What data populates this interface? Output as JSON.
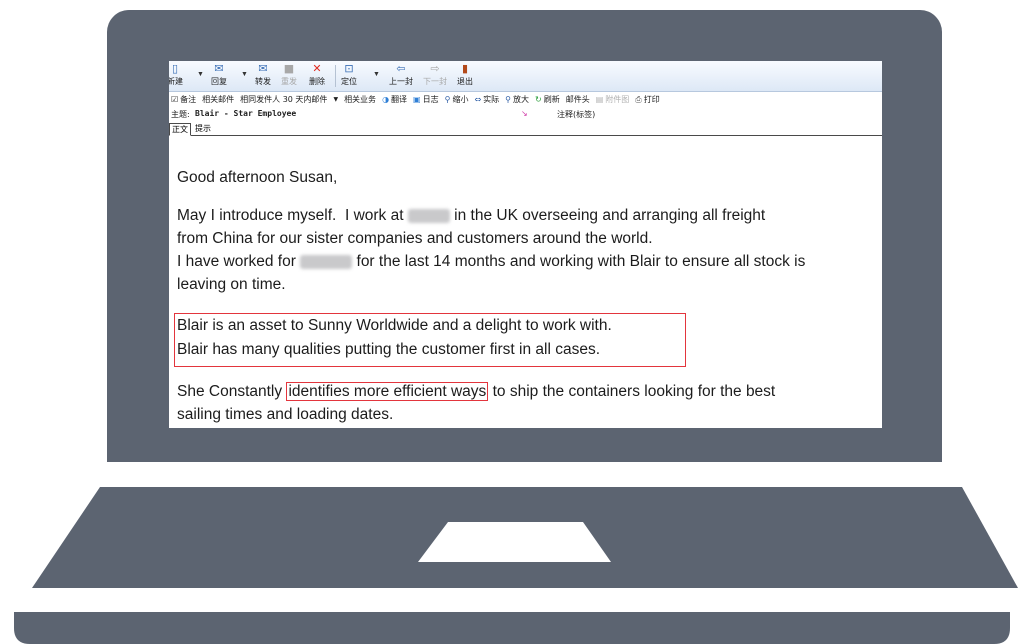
{
  "toolbar": {
    "buttons": [
      {
        "label": "新建",
        "icon": "new-mail-icon",
        "enabled": true
      },
      {
        "label": "回复",
        "icon": "reply-icon",
        "enabled": true
      },
      {
        "label": "转发",
        "icon": "forward-icon",
        "enabled": true
      },
      {
        "label": "重发",
        "icon": "resend-icon",
        "enabled": false
      },
      {
        "label": "删除",
        "icon": "delete-icon",
        "enabled": true
      },
      {
        "label": "定位",
        "icon": "locate-icon",
        "enabled": true
      },
      {
        "label": "上一封",
        "icon": "previous-icon",
        "enabled": true
      },
      {
        "label": "下一封",
        "icon": "next-icon",
        "enabled": false
      },
      {
        "label": "退出",
        "icon": "exit-icon",
        "enabled": true
      }
    ]
  },
  "toolbar2": {
    "items": [
      {
        "label": "备注"
      },
      {
        "label": "相关邮件"
      },
      {
        "label": "相同发件人 30 天内邮件"
      },
      {
        "label": "相关业务"
      },
      {
        "label": "翻译"
      },
      {
        "label": "日志"
      },
      {
        "label": "缩小"
      },
      {
        "label": "实际"
      },
      {
        "label": "放大"
      },
      {
        "label": "刷新"
      },
      {
        "label": "邮件头"
      },
      {
        "label": "附件图"
      },
      {
        "label": "打印"
      }
    ]
  },
  "header": {
    "subject_label": "主题:",
    "subject": "Blair - Star Employee",
    "note_label": "注释(标签)"
  },
  "tabs": [
    {
      "label": "正文"
    },
    {
      "label": "提示"
    }
  ],
  "email": {
    "greeting": "Good afternoon Susan,",
    "p1_a": "May I introduce myself.  I work at ",
    "p1_b": " in the UK overseeing and arranging all freight",
    "p1_line2": "from China for our sister companies and customers around the world.",
    "p2_a": "I have worked for ",
    "p2_b": " for the last 14 months and working with Blair to ensure all stock is",
    "p2_line2": "leaving on time.",
    "highlight1": "Blair is an asset to Sunny Worldwide and a delight to work with.",
    "highlight2": "Blair has many qualities putting the customer first in all cases.",
    "p4_a": "She Constantly ",
    "p4_highlight": "identifies more efficient ways",
    "p4_b": " to ship the containers looking for the best",
    "p4_line2": "sailing times and loading dates."
  },
  "colors": {
    "laptop": "#5c6471",
    "highlight_border": "#e3353d"
  }
}
